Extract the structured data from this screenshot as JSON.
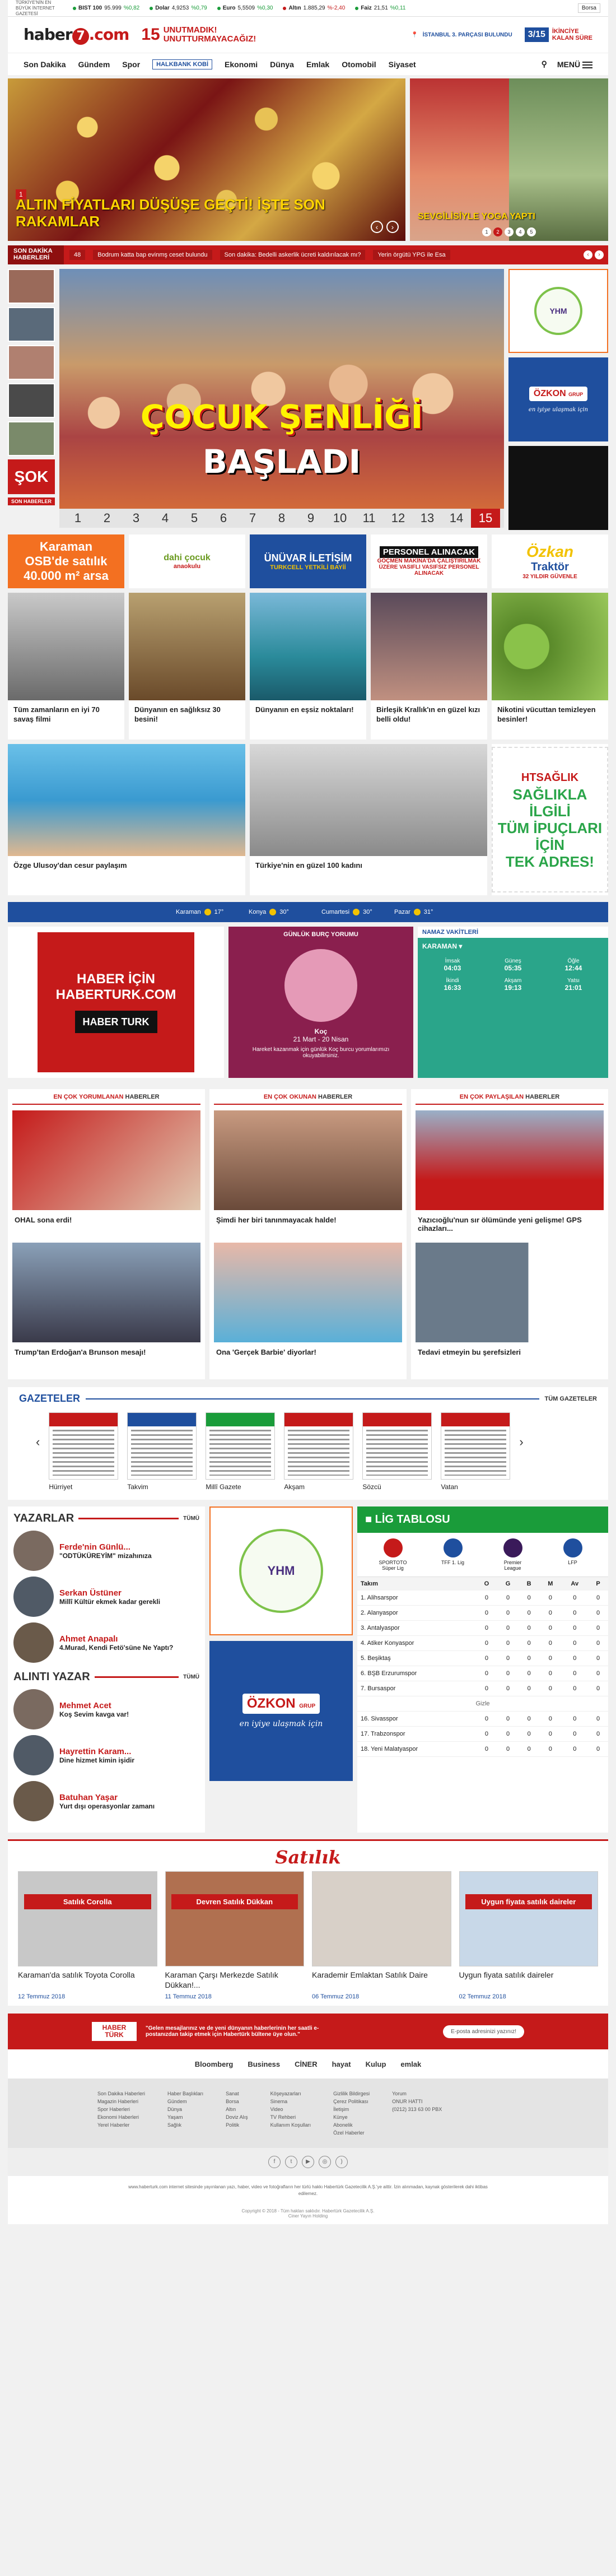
{
  "topbar": {
    "tag": "TÜRKİYE'NİN EN BÜYÜK İNTERNET GAZETESİ",
    "markets": [
      {
        "name": "BIST 100",
        "value": "95.999",
        "change": "%0,82",
        "dir": "up",
        "color": "#1a9c3a"
      },
      {
        "name": "Dolar",
        "value": "4,9253",
        "change": "%0,79",
        "dir": "up",
        "color": "#1a9c3a"
      },
      {
        "name": "Euro",
        "value": "5,5509",
        "change": "%0,30",
        "dir": "up",
        "color": "#1a9c3a"
      },
      {
        "name": "Altın",
        "value": "1.885,29",
        "change": "%-2,40",
        "dir": "dn",
        "color": "#c51a1a"
      },
      {
        "name": "Faiz",
        "value": "21,51",
        "change": "%0,11",
        "dir": "up",
        "color": "#1a9c3a"
      }
    ],
    "borsa": "Borsa"
  },
  "header": {
    "logo_a": "haber",
    "logo_7": "7",
    "logo_b": ".com",
    "t15": "15",
    "t15a": "UNUTMADIK!",
    "t15b": "UNUTTURMAYACAĞIZ!",
    "ist": "İSTANBUL 3. PARÇASI BULUNDU",
    "cd_num": "3/15",
    "cd_a": "İKİNCİYE",
    "cd_b": "KALAN SÜRE"
  },
  "nav": {
    "items": [
      "Son Dakika",
      "Gündem",
      "Spor"
    ],
    "hb": "HALKBANK KOBİ",
    "items2": [
      "Ekonomi",
      "Dünya",
      "Emlak",
      "Otomobil",
      "Siyaset"
    ],
    "menu": "MENÜ"
  },
  "hero": {
    "num": "1",
    "caption": "ALTIN FİYATLARI DÜŞÜŞE GEÇTİ! İŞTE SON RAKAMLAR",
    "right_caption": "SEVGİLİSİYLE YOGA YAPTI",
    "dots": [
      "1",
      "2",
      "3",
      "4",
      "5"
    ]
  },
  "breaking": {
    "label_a": "SON DAKİKA",
    "label_b": "HABERLERİ",
    "items": [
      "48",
      "Bodrum katta bap evinmş ceset bulundu",
      "Son dakika: Bedelli askerlik ücreti kaldırılacak mı?",
      "Yerin örgütü YPG ile Esa"
    ]
  },
  "manset": {
    "sok": "ŞOK",
    "sok2": "SON HABERLER",
    "t1": "ÇOCUK ŞENLİĞİ",
    "t2": "BAŞLADI",
    "pages": [
      "1",
      "2",
      "3",
      "4",
      "5",
      "6",
      "7",
      "8",
      "9",
      "10",
      "11",
      "12",
      "13",
      "14",
      "15"
    ],
    "active": "15"
  },
  "ads": {
    "ymh": "YHM",
    "ozkon": "ÖZKON",
    "ozkon_sub": "GRUP",
    "ozkon_slogan": "en iyiye ulaşmak için"
  },
  "banners": {
    "b1a": "Karaman",
    "b1b": "OSB'de satılık",
    "b1c": "40.000 m² arsa",
    "b2a": "dahi çocuk",
    "b2b": "anaokulu",
    "b3a": "ÜNÜVAR İLETİŞİM",
    "b3b": "TURKCELL YETKİLİ BAYİİ",
    "b4a": "PERSONEL ALINACAK",
    "b4b": "GÖÇMEN MAKİNA'DA ÇALIŞTIRILMAK ÜZERE VASIFLI VASIFSIZ PERSONEL ALINACAK",
    "b5a": "Özkan",
    "b5b": "Traktör",
    "b5c": "32 YILDIR GÜVENLE"
  },
  "news": [
    {
      "title": "Tüm zamanların en iyi 70 savaş filmi"
    },
    {
      "title": "Dünyanın en sağlıksız 30 besini!"
    },
    {
      "title": "Dünyanın en eşsiz noktaları!"
    },
    {
      "title": "Birleşik Krallık'ın en güzel kızı belli oldu!"
    },
    {
      "title": "Nikotini vücuttan temizleyen besinler!"
    }
  ],
  "news2": [
    {
      "title": "Özge Ulusoy'dan cesur paylaşım"
    },
    {
      "title": "Türkiye'nin en güzel 100 kadını"
    }
  ],
  "saglik": {
    "ht": "HTSAĞLIK",
    "a": "SAĞLIKLA İLGİLİ",
    "b": "TÜM İPUÇLARI İÇİN",
    "c": "TEK ADRES!"
  },
  "weather": {
    "items": [
      {
        "city": "Karaman",
        "t": "17°"
      },
      {
        "city": "Konya",
        "t": "30°"
      },
      {
        "city": "Cumartesi",
        "t": "30°"
      },
      {
        "city": "Pazar",
        "t": "31°"
      }
    ]
  },
  "htad": {
    "a": "HABER İÇİN",
    "b": "HABERTURK.COM",
    "c": "HABER TURK"
  },
  "burc": {
    "title": "GÜNLÜK BURÇ YORUMU",
    "sign": "Koç",
    "dates": "21 Mart - 20 Nisan",
    "text": "Hareket kazanmak için günlük Koç burcu yorumlarımızı okuyabilirsiniz."
  },
  "namaz": {
    "title": "NAMAZ VAKİTLERİ",
    "city": "KARAMAN",
    "times": [
      {
        "n": "İmsak",
        "t": "04:03"
      },
      {
        "n": "Güneş",
        "t": "05:35"
      },
      {
        "n": "Öğle",
        "t": "12:44"
      },
      {
        "n": "İkindi",
        "t": "16:33"
      },
      {
        "n": "Akşam",
        "t": "19:13"
      },
      {
        "n": "Yatsı",
        "t": "21:01"
      }
    ]
  },
  "most": [
    {
      "h1": "EN ÇOK YORUMLANAN",
      "h2": "HABERLER",
      "items": [
        "OHAL sona erdi!",
        "Trump'tan Erdoğan'a Brunson mesajı!"
      ]
    },
    {
      "h1": "EN ÇOK OKUNAN",
      "h2": "HABERLER",
      "items": [
        "Şimdi her biri tanınmayacak halde!",
        "Ona 'Gerçek Barbie' diyorlar!"
      ]
    },
    {
      "h1": "EN ÇOK PAYLAŞILAN",
      "h2": "HABERLER",
      "items": [
        "Yazıcıoğlu'nun sır ölümünde yeni gelişme! GPS cihazları...",
        "Tedavi etmeyin bu şerefsizleri"
      ]
    }
  ],
  "gazeteler": {
    "title": "GAZETELER",
    "all": "TÜM GAZETELER",
    "papers": [
      "Hürriyet",
      "Takvim",
      "Millî Gazete",
      "Akşam",
      "Sözcü",
      "Vatan"
    ]
  },
  "yazarlar": {
    "title": "YAZARLAR",
    "all": "TÜMÜ",
    "list": [
      {
        "name": "Ferde'nin Günlü...",
        "title": "\"ODTÜKÜREYİM\" mizahınıza"
      },
      {
        "name": "Serkan Üstüner",
        "title": "Millî Kültür ekmek kadar gerekli"
      },
      {
        "name": "Ahmet Anapalı",
        "title": "4.Murad, Kendi Fetö'süne Ne Yaptı?"
      }
    ]
  },
  "alinti": {
    "title": "ALINTI YAZAR",
    "all": "TÜMÜ",
    "list": [
      {
        "name": "Mehmet Acet",
        "title": "Koş Sevim kavga var!"
      },
      {
        "name": "Hayrettin Karam...",
        "title": "Dine hizmet kimin işidir"
      },
      {
        "name": "Batuhan Yaşar",
        "title": "Yurt dışı operasyonlar zamanı"
      }
    ]
  },
  "lig": {
    "title": "LİG TABLOSU",
    "tabs": [
      "SPORTOTO Süper Lig",
      "TFF 1. Lig",
      "Premier League",
      "LFP"
    ],
    "headers": [
      "Takım",
      "O",
      "G",
      "B",
      "M",
      "Av",
      "P"
    ],
    "rows": [
      [
        "1. Alihsarspor",
        "0",
        "0",
        "0",
        "0",
        "0",
        "0"
      ],
      [
        "2. Alanyaspor",
        "0",
        "0",
        "0",
        "0",
        "0",
        "0"
      ],
      [
        "3. Antalyaspor",
        "0",
        "0",
        "0",
        "0",
        "0",
        "0"
      ],
      [
        "4. Atiker Konyaspor",
        "0",
        "0",
        "0",
        "0",
        "0",
        "0"
      ],
      [
        "5. Beşiktaş",
        "0",
        "0",
        "0",
        "0",
        "0",
        "0"
      ],
      [
        "6. BŞB Erzurumspor",
        "0",
        "0",
        "0",
        "0",
        "0",
        "0"
      ],
      [
        "7. Bursaspor",
        "0",
        "0",
        "0",
        "0",
        "0",
        "0"
      ]
    ],
    "gizle": "Gizle",
    "rows2": [
      [
        "16. Sivasspor",
        "0",
        "0",
        "0",
        "0",
        "0",
        "0"
      ],
      [
        "17. Trabzonspor",
        "0",
        "0",
        "0",
        "0",
        "0",
        "0"
      ],
      [
        "18. Yeni Malatyaspor",
        "0",
        "0",
        "0",
        "0",
        "0",
        "0"
      ]
    ]
  },
  "satilik": {
    "title": "Satılık",
    "items": [
      {
        "title": "Karaman'da satılık Toyota Corolla",
        "date": "12 Temmuz 2018",
        "sign": "Satılık Corolla"
      },
      {
        "title": "Karaman Çarşı Merkezde Satılık Dükkan!...",
        "date": "11 Temmuz 2018",
        "sign": "Devren Satılık Dükkan"
      },
      {
        "title": "Karademir Emlaktan Satılık Daire",
        "date": "06 Temmuz 2018",
        "sign": ""
      },
      {
        "title": "Uygun fiyata satılık daireler",
        "date": "02 Temmuz 2018",
        "sign": "Uygun fiyata satılık daireler"
      }
    ]
  },
  "ticker": {
    "hl": "HABER TÜRK",
    "text": "\"Gelen mesajlarınız ve de yeni dünyanın haberlerinin her saatli e-postanızdan takip etmek için Habertürk bültene üye olun.\"",
    "input": "E-posta adresinizi yazınız!"
  },
  "partners": [
    "Bloomberg",
    "Business",
    "CİNER",
    "hayat",
    "Kulup",
    "emlak"
  ],
  "footer": {
    "cols": [
      [
        "Son Dakika Haberleri",
        "Magazin Haberleri",
        "Spor Haberleri",
        "Ekonomi Haberleri",
        "Yerel Haberler"
      ],
      [
        "Haber Başlıkları",
        "Gündem",
        "Dünya",
        "Yaşam",
        "Sağlık"
      ],
      [
        "Sanat",
        "Borsa",
        "Altın",
        "Doviz Alış",
        "Politik"
      ],
      [
        "Köşeyazarları",
        "Sinema",
        "Video",
        "TV Rehberi",
        "Kullanım Koşulları"
      ],
      [
        "Gizlilik Bildirgesi",
        "Çerez Politikası",
        "İletişim",
        "Künye",
        "Abonelik",
        "Özel Haberler"
      ],
      [
        "Yorum",
        "ONUR HATTI",
        "(0212) 313 63 00 PBX"
      ]
    ],
    "legal": "www.haberturk.com internet sitesinde yayınlanan yazı, haber, video ve fotoğrafların her türlü hakkı Habertürk Gazetecilik A.Ş.'ye aittir. İzin alınmadan, kaynak gösterilerek dahi iktibas edilemez.",
    "copy": "Copyright © 2018 - Tüm hakları saklıdır. Habertürk Gazetecilik A.Ş.",
    "group": "Ciner Yayın Holding"
  }
}
